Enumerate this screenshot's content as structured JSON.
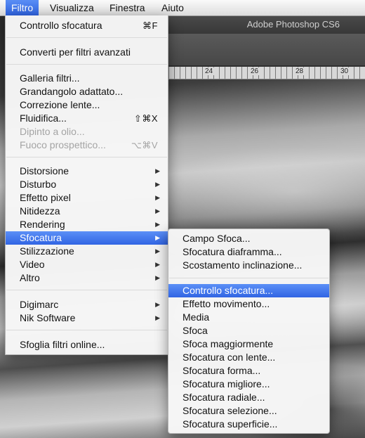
{
  "menubar": {
    "items": [
      {
        "label": "Filtro",
        "active": true
      },
      {
        "label": "Visualizza",
        "active": false
      },
      {
        "label": "Finestra",
        "active": false
      },
      {
        "label": "Aiuto",
        "active": false
      }
    ]
  },
  "app": {
    "title": "Adobe Photoshop CS6",
    "ruler_ticks": [
      "24",
      "26",
      "28",
      "30"
    ]
  },
  "filter_menu": {
    "last_filter": {
      "label": "Controllo sfocatura",
      "shortcut": "⌘F"
    },
    "smart_filters": "Converti per filtri avanzati",
    "filter_gallery": "Galleria filtri...",
    "adaptive_wide": "Grandangolo adattato...",
    "lens_correction": "Correzione lente...",
    "liquify": {
      "label": "Fluidifica...",
      "shortcut": "⇧⌘X"
    },
    "oil_paint": "Dipinto a olio...",
    "vanishing_point": {
      "label": "Fuoco prospettico...",
      "shortcut": "⌥⌘V"
    },
    "groups": [
      "Distorsione",
      "Disturbo",
      "Effetto pixel",
      "Nitidezza",
      "Rendering",
      "Sfocatura",
      "Stilizzazione",
      "Video",
      "Altro"
    ],
    "plugins": [
      "Digimarc",
      "Nik Software"
    ],
    "browse_online": "Sfoglia filtri online...",
    "arrow_glyph": "▶"
  },
  "blur_submenu": {
    "gallery": [
      "Campo Sfoca...",
      "Sfocatura diaframma...",
      "Scostamento inclinazione..."
    ],
    "items": [
      "Controllo sfocatura...",
      "Effetto movimento...",
      "Media",
      "Sfoca",
      "Sfoca maggiormente",
      "Sfocatura con lente...",
      "Sfocatura forma...",
      "Sfocatura migliore...",
      "Sfocatura radiale...",
      "Sfocatura selezione...",
      "Sfocatura superficie..."
    ],
    "highlighted_index": 0
  },
  "colors": {
    "highlight": "#3165e3",
    "disabled_text": "#a4a4a4"
  }
}
